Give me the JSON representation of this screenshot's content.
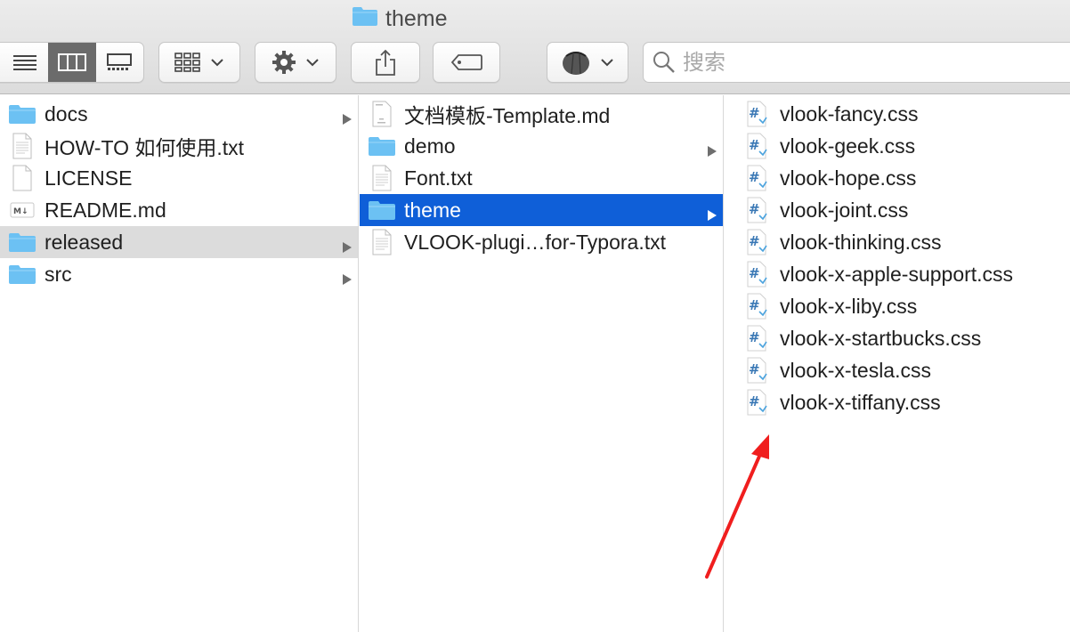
{
  "window": {
    "title": "theme"
  },
  "toolbar": {
    "view_buttons": [
      "list-view",
      "column-view",
      "gallery-view"
    ],
    "search_placeholder": "搜索"
  },
  "columns": [
    {
      "items": [
        {
          "label": "docs",
          "kind": "folder",
          "has_children": true
        },
        {
          "label": "HOW-TO 如何使用.txt",
          "kind": "txt"
        },
        {
          "label": "LICENSE",
          "kind": "blank"
        },
        {
          "label": "README.md",
          "kind": "md"
        },
        {
          "label": "released",
          "kind": "folder",
          "has_children": true,
          "selected": "inactive"
        },
        {
          "label": "src",
          "kind": "folder",
          "has_children": true
        }
      ]
    },
    {
      "items": [
        {
          "label": "文档模板-Template.md",
          "kind": "md-doc"
        },
        {
          "label": "demo",
          "kind": "folder",
          "has_children": true
        },
        {
          "label": "Font.txt",
          "kind": "txt"
        },
        {
          "label": "theme",
          "kind": "folder",
          "has_children": true,
          "selected": "active"
        },
        {
          "label": "VLOOK-plugi…for-Typora.txt",
          "kind": "txt"
        }
      ]
    },
    {
      "items": [
        {
          "label": "vlook-fancy.css",
          "kind": "css"
        },
        {
          "label": "vlook-geek.css",
          "kind": "css"
        },
        {
          "label": "vlook-hope.css",
          "kind": "css"
        },
        {
          "label": "vlook-joint.css",
          "kind": "css"
        },
        {
          "label": "vlook-thinking.css",
          "kind": "css"
        },
        {
          "label": "vlook-x-apple-support.css",
          "kind": "css"
        },
        {
          "label": "vlook-x-liby.css",
          "kind": "css"
        },
        {
          "label": "vlook-x-startbucks.css",
          "kind": "css"
        },
        {
          "label": "vlook-x-tesla.css",
          "kind": "css"
        },
        {
          "label": "vlook-x-tiffany.css",
          "kind": "css"
        }
      ]
    }
  ],
  "colors": {
    "accent_selection": "#0f5fd8",
    "inactive_selection": "#dcdcdc",
    "folder": "#6cc1f3",
    "annotation_arrow": "#f01e1e"
  }
}
